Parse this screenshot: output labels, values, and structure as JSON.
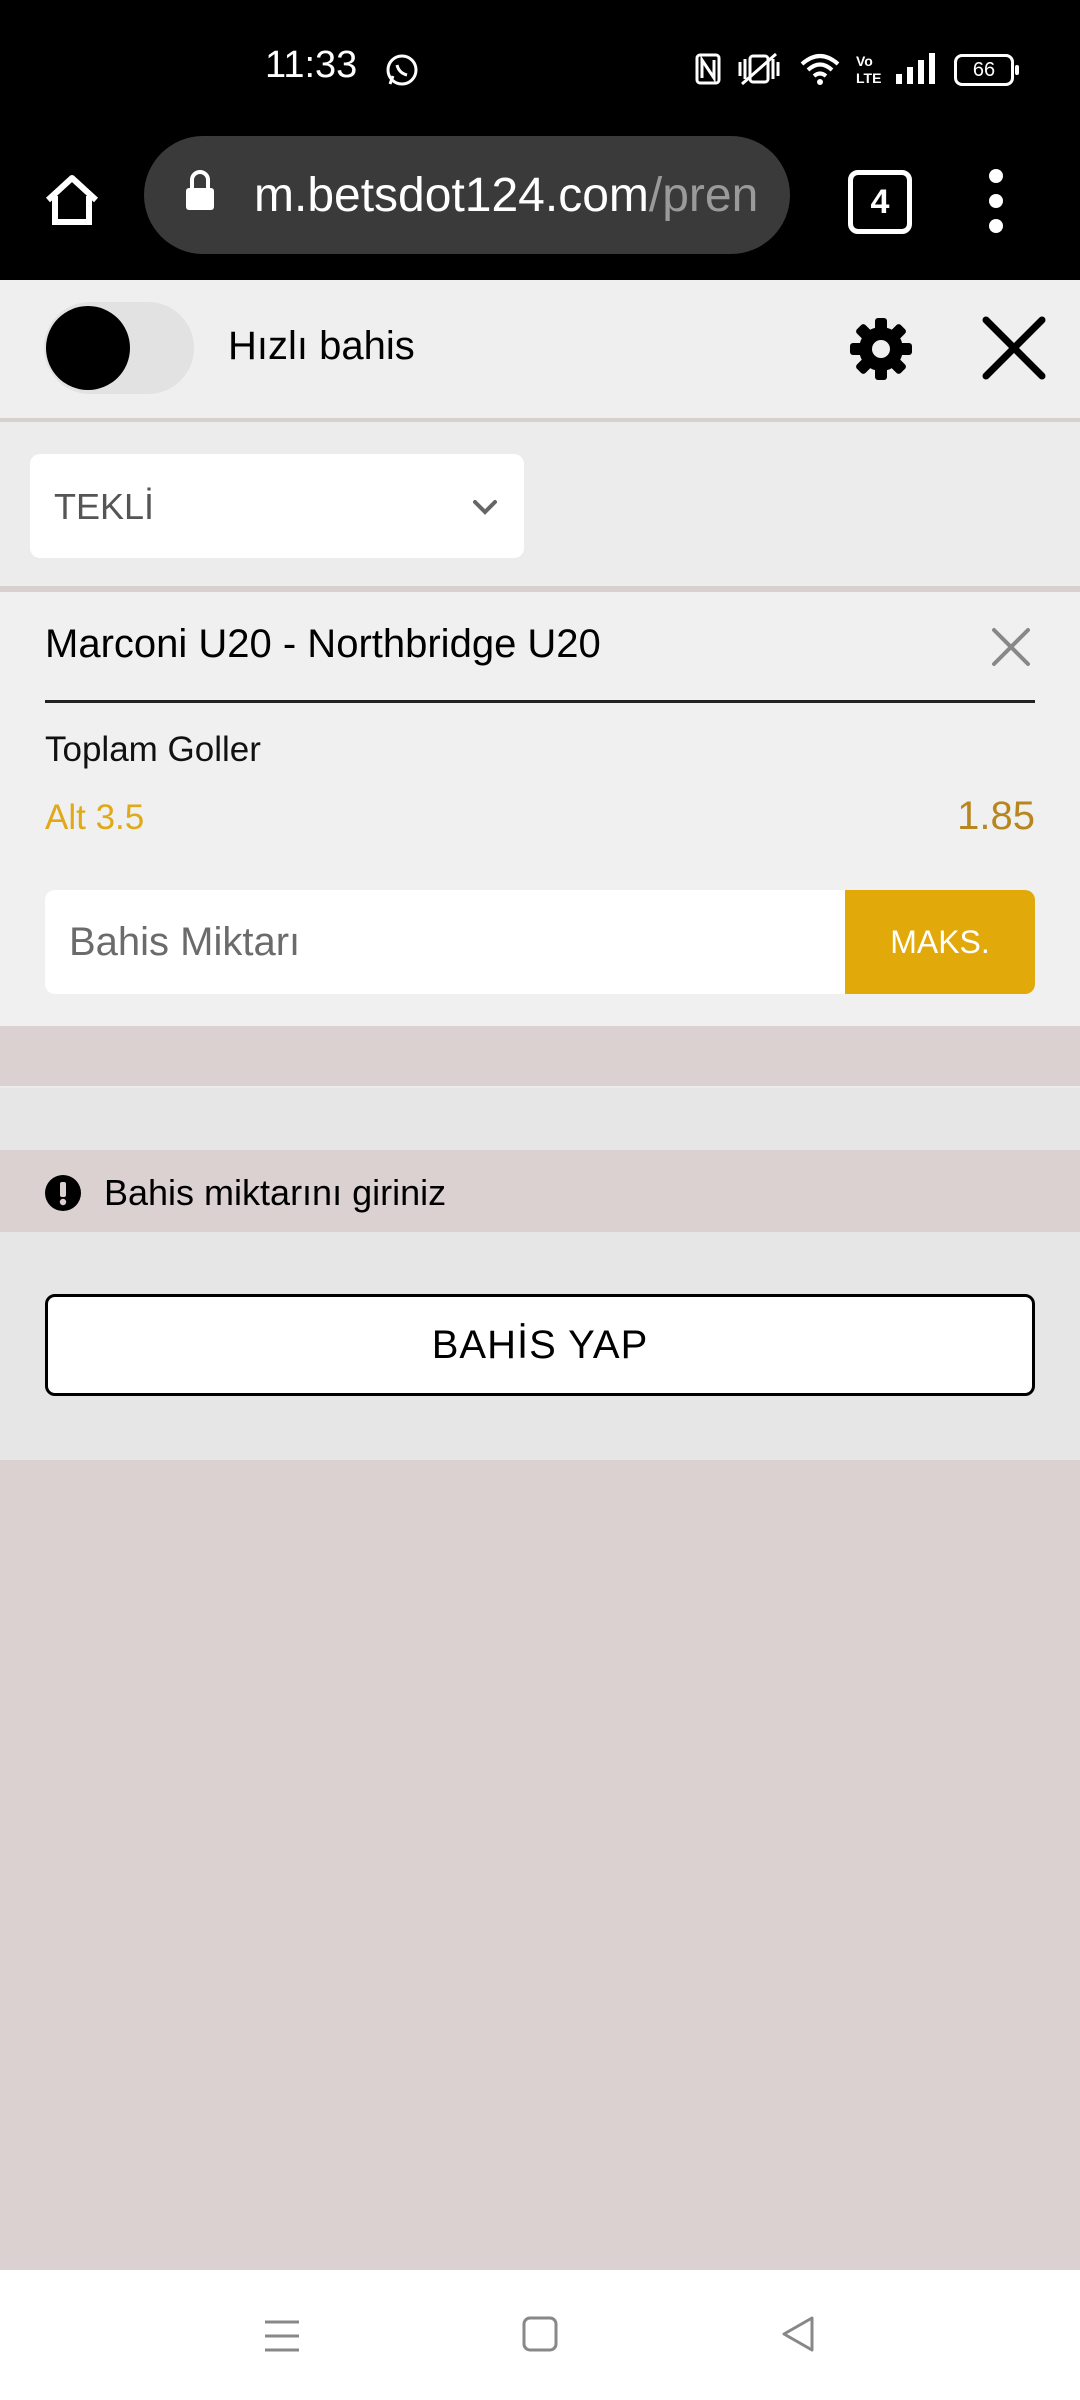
{
  "status_bar": {
    "time": "11:33",
    "battery": "66",
    "icons": [
      "whatsapp-icon",
      "nfc-icon",
      "vibrate-icon",
      "wifi-icon",
      "volte-icon",
      "signal-icon",
      "battery-icon"
    ]
  },
  "browser": {
    "url_host": "m.betsdot124.com",
    "url_path": "/pren",
    "tab_count": "4",
    "icons": [
      "home-icon",
      "lock-icon",
      "more-vert-icon"
    ]
  },
  "toolbar": {
    "quick_bet_label": "Hızlı bahis",
    "icons": [
      "settings-gear-icon",
      "close-icon"
    ]
  },
  "mode": {
    "selected": "TEKLİ"
  },
  "bet": {
    "match": "Marconi U20 - Northbridge U20",
    "market": "Toplam Goller",
    "selection": "Alt 3.5",
    "odds": "1.85",
    "stake_placeholder": "Bahis Miktarı",
    "max_label": "MAKS."
  },
  "warning": {
    "text": "Bahis miktarını giriniz"
  },
  "actions": {
    "place_bet": "BAHİS YAP"
  },
  "colors": {
    "accent": "#e2a90b",
    "selection": "#e0a917",
    "odds": "#b8861e",
    "background": "#dbd1d1"
  }
}
